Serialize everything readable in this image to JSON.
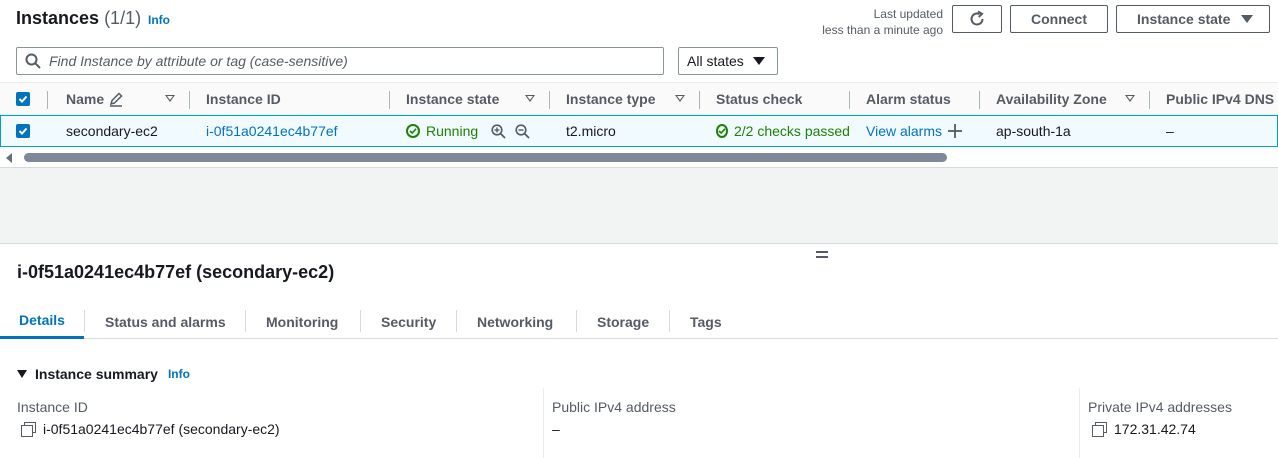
{
  "header": {
    "title": "Instances",
    "count": "(1/1)",
    "info": "Info",
    "last_updated_line1": "Last updated",
    "last_updated_line2": "less than a minute ago",
    "connect_label": "Connect",
    "instance_state_label": "Instance state"
  },
  "search": {
    "placeholder": "Find Instance by attribute or tag (case-sensitive)"
  },
  "state_filter": {
    "selected": "All states"
  },
  "table": {
    "columns": [
      "Name",
      "Instance ID",
      "Instance state",
      "Instance type",
      "Status check",
      "Alarm status",
      "Availability Zone",
      "Public IPv4 DNS"
    ],
    "rows": [
      {
        "name": "secondary-ec2",
        "instance_id": "i-0f51a0241ec4b77ef",
        "state": "Running",
        "type": "t2.micro",
        "status_check": "2/2 checks passed",
        "alarm": "View alarms",
        "az": "ap-south-1a",
        "public_dns": "–"
      }
    ]
  },
  "detail": {
    "title": "i-0f51a0241ec4b77ef (secondary-ec2)",
    "tabs": [
      "Details",
      "Status and alarms",
      "Monitoring",
      "Security",
      "Networking",
      "Storage",
      "Tags"
    ],
    "section_title": "Instance summary",
    "section_info": "Info",
    "fields": [
      {
        "label": "Instance ID",
        "value": "i-0f51a0241ec4b77ef (secondary-ec2)"
      },
      {
        "label": "Public IPv4 address",
        "value": "–"
      },
      {
        "label": "Private IPv4 addresses",
        "value": "172.31.42.74"
      }
    ]
  },
  "colors": {
    "link": "#0073bb",
    "success": "#1d8102",
    "selected_row_bg": "#f1faff",
    "selected_row_border": "#00a1c9"
  }
}
